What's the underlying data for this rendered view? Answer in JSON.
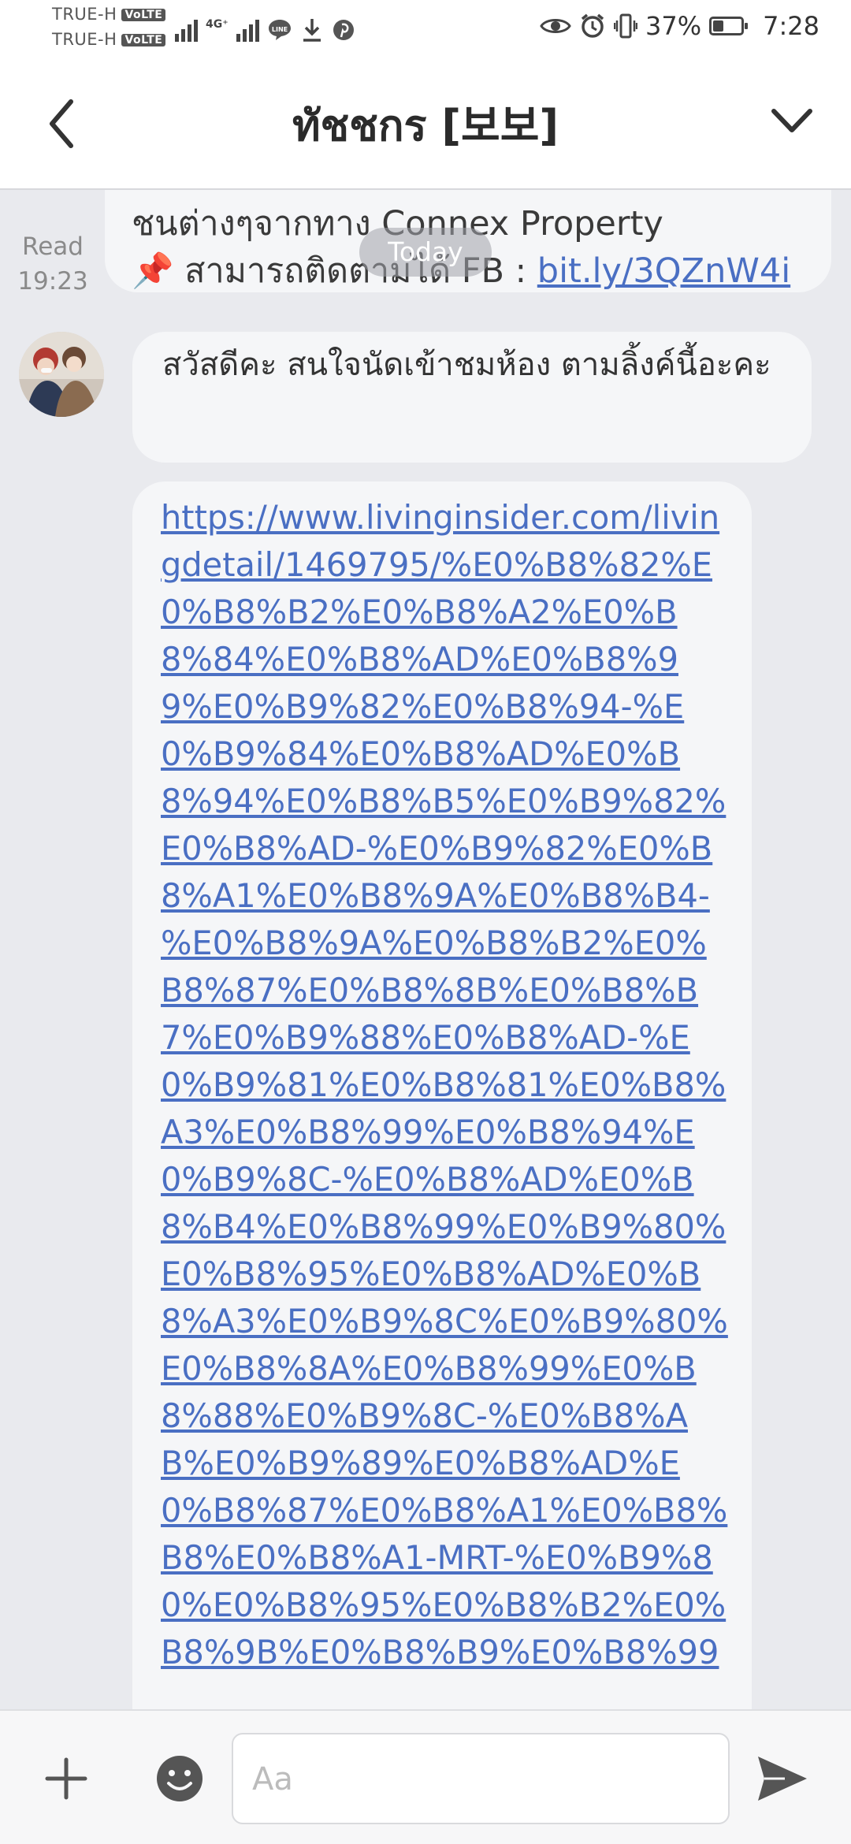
{
  "status_bar": {
    "carrier_1": "TRUE-H",
    "carrier_2": "TRUE-H",
    "volte_badge": "VoLTE",
    "network_type": "4G⁺",
    "battery_percent": "37%",
    "battery_level": 0.37,
    "time": "7:28"
  },
  "header": {
    "title": "ทัชชกร [보보]"
  },
  "messages": {
    "previous_line_1": "ชนต่างๆจากทาง Connex Property",
    "previous_line_2_pin": "📌",
    "previous_line_2_text": " สามารถติดตามได้ FB : ",
    "previous_link": "bit.ly/3QZnW4i",
    "read_label": "Read",
    "read_time": "19:23",
    "date_divider": "Today",
    "greeting": "สวัสดีคะ สนใจนัดเข้าชมห้อง ตามลิ้งค์นี้อะคะ",
    "url": "https://www.livinginsider.com/livingdetail/1469795/%E0%B8%82%E0%B8%B2%E0%B8%A2%E0%B8%84%E0%B8%AD%E0%B8%99%E0%B9%82%E0%B8%94-%E0%B9%84%E0%B8%AD%E0%B8%94%E0%B8%B5%E0%B9%82%E0%B8%AD-%E0%B9%82%E0%B8%A1%E0%B8%9A%E0%B8%B4-%E0%B8%9A%E0%B8%B2%E0%B8%87%E0%B8%8B%E0%B8%B7%E0%B9%88%E0%B8%AD-%E0%B9%81%E0%B8%81%E0%B8%A3%E0%B8%99%E0%B8%94%E0%B9%8C-%E0%B8%AD%E0%B8%B4%E0%B8%99%E0%B9%80%E0%B8%95%E0%B8%AD%E0%B8%A3%E0%B9%8C%E0%B9%80%E0%B8%8A%E0%B8%99%E0%B8%88%E0%B9%8C-%E0%B8%AB%E0%B9%89%E0%B8%AD%E0%B8%87%E0%B8%A1%E0%B8%B8%E0%B8%A1-MRT-%E0%B9%80%E0%B8%95%E0%B8%B2%E0%B8%9B%E0%B8%B9%E0%B8%99"
  },
  "input": {
    "placeholder": "Aa"
  },
  "icons": {
    "back": "chevron-left-icon",
    "collapse": "chevron-down-icon",
    "add": "plus-icon",
    "emoji": "smile-icon",
    "send": "send-icon"
  },
  "colors": {
    "link": "#4a6fc3",
    "bubble": "#f5f6f8",
    "chat_background": "#e9eaee"
  }
}
